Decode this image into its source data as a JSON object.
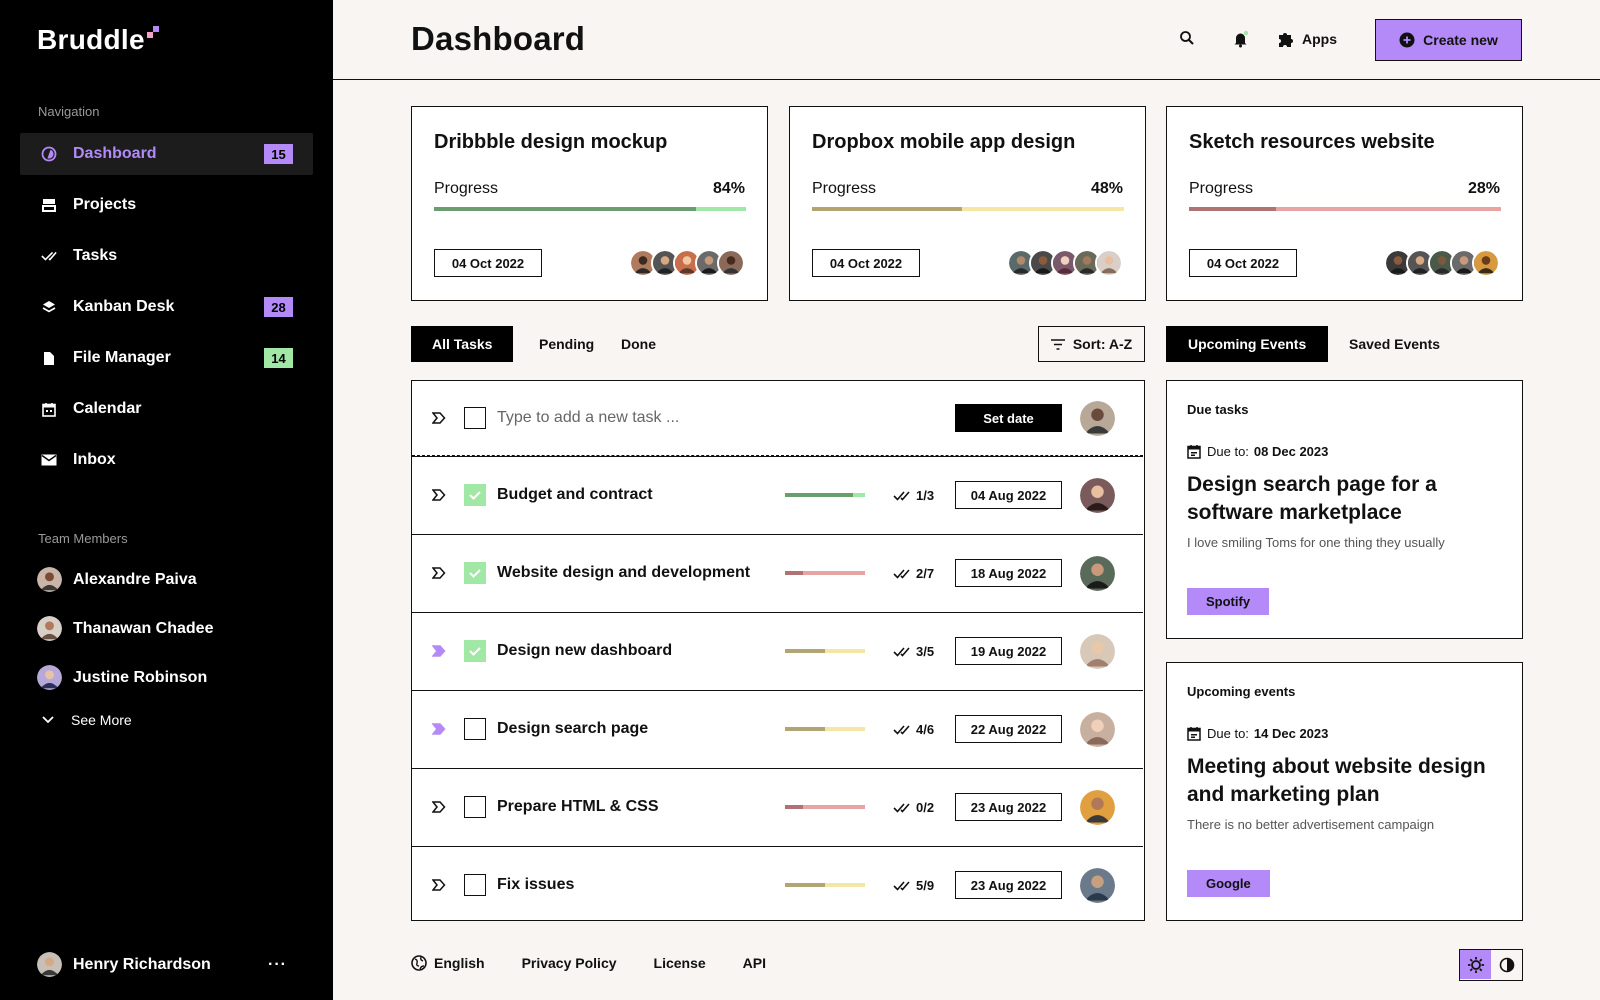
{
  "app": {
    "name": "Bruddle"
  },
  "sidebar": {
    "nav_label": "Navigation",
    "items": [
      {
        "label": "Dashboard",
        "badge": "15",
        "icon": "dashboard-icon",
        "active": true
      },
      {
        "label": "Projects",
        "icon": "projects-icon"
      },
      {
        "label": "Tasks",
        "icon": "tasks-icon"
      },
      {
        "label": "Kanban Desk",
        "badge": "28",
        "icon": "layers-icon"
      },
      {
        "label": "File Manager",
        "badge": "14",
        "icon": "file-icon"
      },
      {
        "label": "Calendar",
        "icon": "calendar-icon"
      },
      {
        "label": "Inbox",
        "icon": "mail-icon"
      }
    ],
    "team_label": "Team Members",
    "members": [
      {
        "name": "Alexandre Paiva"
      },
      {
        "name": "Thanawan Chadee"
      },
      {
        "name": "Justine Robinson"
      }
    ],
    "see_more": "See More",
    "profile": {
      "name": "Henry Richardson",
      "more": "···"
    }
  },
  "header": {
    "title": "Dashboard",
    "apps_label": "Apps",
    "create_label": "Create new"
  },
  "colors": {
    "accent": "#b38af7",
    "green": "#a1e8a6",
    "green_dark": "#6b9e6e",
    "yellow": "#f4e7a5",
    "yellow_dark": "#b0a573",
    "red": "#e8a3a3",
    "red_dark": "#b07373"
  },
  "projects": [
    {
      "title": "Dribbble design mockup",
      "progress_label": "Progress",
      "progress_text": "84%",
      "progress": 0.84,
      "date": "04 Oct 2022"
    },
    {
      "title": "Dropbox mobile app design",
      "progress_label": "Progress",
      "progress_text": "48%",
      "progress": 0.48,
      "date": "04 Oct 2022"
    },
    {
      "title": "Sketch resources website",
      "progress_label": "Progress",
      "progress_text": "28%",
      "progress": 0.28,
      "date": "04 Oct 2022"
    }
  ],
  "task_tabs": {
    "all": "All Tasks",
    "pending": "Pending",
    "done": "Done",
    "sort": "Sort: A-Z"
  },
  "new_task": {
    "placeholder": "Type to add a new task ...",
    "set_date": "Set date"
  },
  "tasks": [
    {
      "name": "Budget and contract",
      "done": true,
      "count": "1/3",
      "progress": 0.85,
      "color": "green",
      "date": "04 Aug 2022",
      "tagged": false
    },
    {
      "name": "Website design and development",
      "done": true,
      "count": "2/7",
      "progress": 0.22,
      "color": "red",
      "date": "18 Aug 2022",
      "tagged": false
    },
    {
      "name": "Design new dashboard",
      "done": true,
      "count": "3/5",
      "progress": 0.5,
      "color": "yellow",
      "date": "19 Aug 2022",
      "tagged": true
    },
    {
      "name": "Design search page",
      "done": false,
      "count": "4/6",
      "progress": 0.5,
      "color": "yellow",
      "date": "22 Aug 2022",
      "tagged": true
    },
    {
      "name": "Prepare HTML & CSS",
      "done": false,
      "count": "0/2",
      "progress": 0.22,
      "color": "red",
      "date": "23 Aug 2022",
      "tagged": false
    },
    {
      "name": "Fix issues",
      "done": false,
      "count": "5/9",
      "progress": 0.5,
      "color": "yellow",
      "date": "23 Aug 2022",
      "tagged": false
    }
  ],
  "event_tabs": {
    "upcoming": "Upcoming Events",
    "saved": "Saved Events"
  },
  "events": [
    {
      "heading": "Due tasks",
      "due_label": "Due to:",
      "due_date": "08 Dec 2023",
      "title": "Design search page for a software marketplace",
      "desc": "I love smiling Toms for one thing they usually",
      "tag": "Spotify"
    },
    {
      "heading": "Upcoming events",
      "due_label": "Due to:",
      "due_date": "14 Dec 2023",
      "title": "Meeting about website design and marketing plan",
      "desc": "There is no better advertisement campaign",
      "tag": "Google"
    }
  ],
  "footer": {
    "language": "English",
    "privacy": "Privacy Policy",
    "license": "License",
    "api": "API"
  }
}
